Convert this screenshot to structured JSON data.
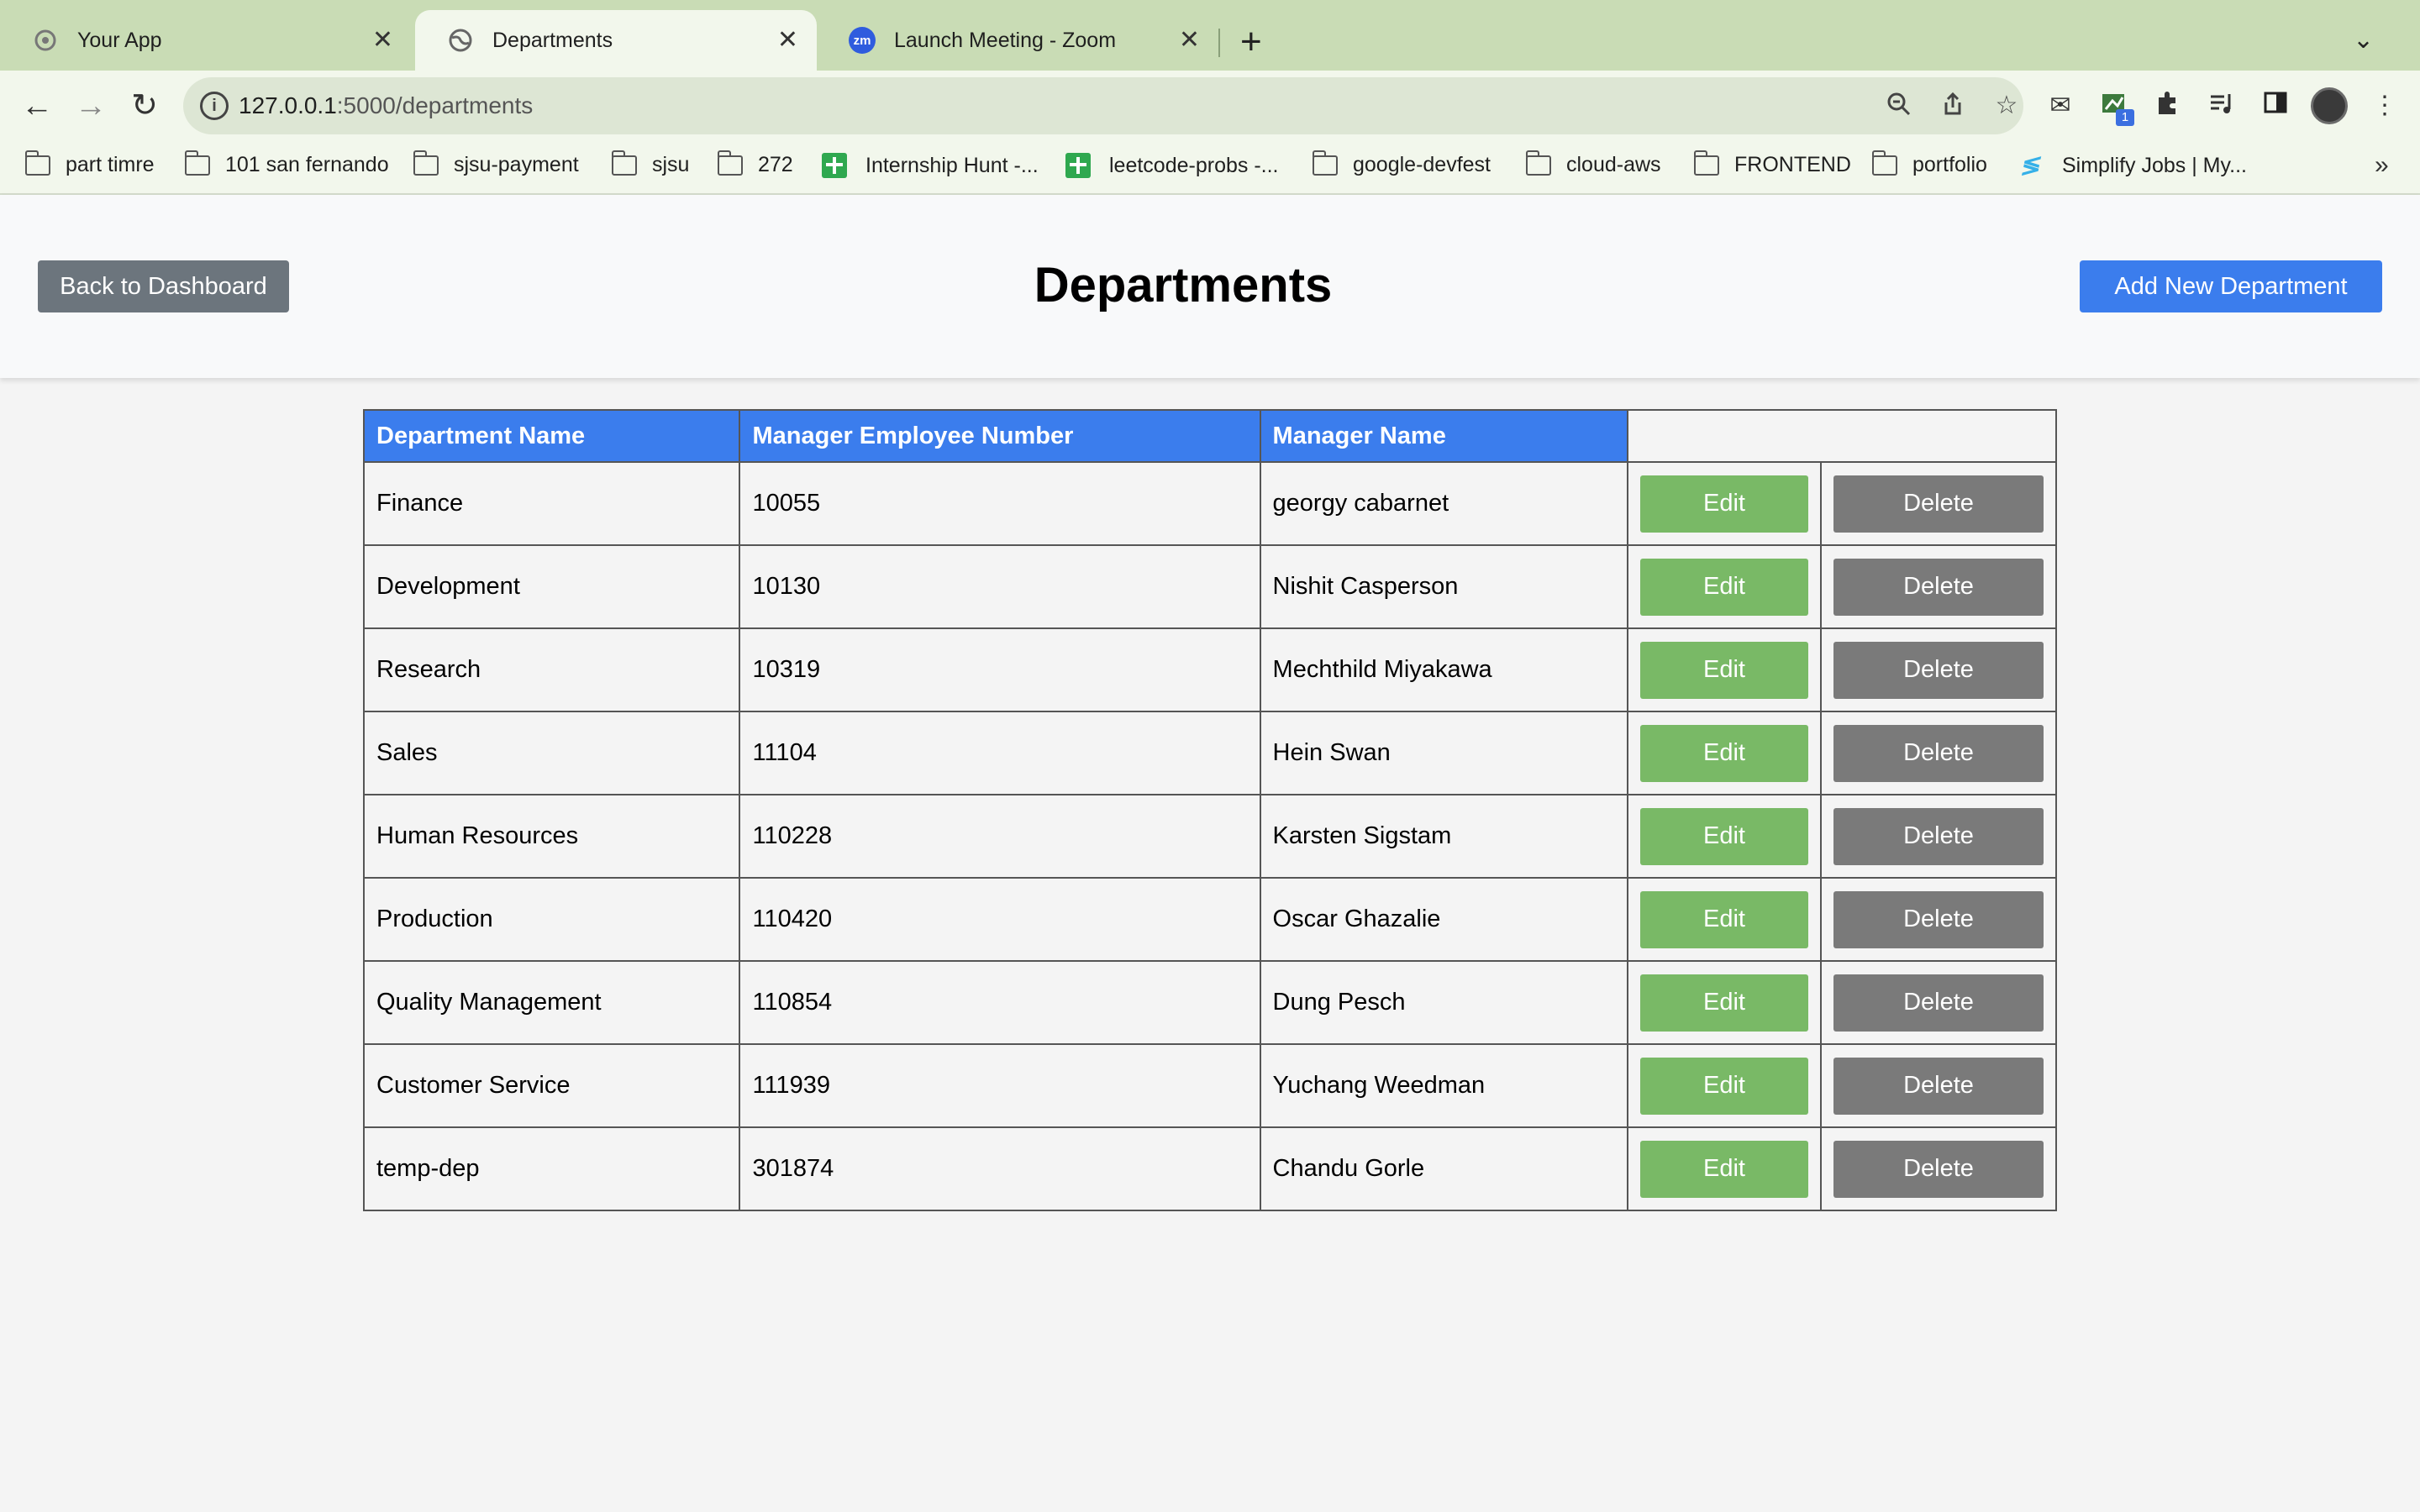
{
  "browser": {
    "tabs": [
      {
        "title": "Your App",
        "icon": "gear-icon"
      },
      {
        "title": "Departments",
        "icon": "globe-icon",
        "active": true
      },
      {
        "title": "Launch Meeting - Zoom",
        "icon": "zoom-icon",
        "icon_text": "zm"
      }
    ],
    "url_host": "127.0.0.1",
    "url_path": ":5000/departments",
    "extension_badge": "1",
    "bookmarks": [
      {
        "label": "part timre",
        "icon": "folder-icon"
      },
      {
        "label": "101 san fernando",
        "icon": "folder-icon"
      },
      {
        "label": "sjsu-payment",
        "icon": "folder-icon"
      },
      {
        "label": "sjsu",
        "icon": "folder-icon"
      },
      {
        "label": "272",
        "icon": "folder-icon"
      },
      {
        "label": "Internship Hunt -...",
        "icon": "sheets-icon"
      },
      {
        "label": "leetcode-probs -...",
        "icon": "sheets-icon"
      },
      {
        "label": "google-devfest",
        "icon": "folder-icon"
      },
      {
        "label": "cloud-aws",
        "icon": "folder-icon"
      },
      {
        "label": "FRONTEND",
        "icon": "folder-icon"
      },
      {
        "label": "portfolio",
        "icon": "folder-icon"
      },
      {
        "label": "Simplify Jobs | My...",
        "icon": "simplify-icon"
      }
    ]
  },
  "page": {
    "title": "Departments",
    "back_button": "Back to Dashboard",
    "add_button": "Add New Department",
    "colors": {
      "primary": "#3b7ded",
      "secondary": "#6c757d",
      "edit": "#79b966",
      "delete": "#7a7a7a"
    }
  },
  "table": {
    "headers": [
      "Department Name",
      "Manager Employee Number",
      "Manager Name"
    ],
    "edit_label": "Edit",
    "delete_label": "Delete",
    "rows": [
      {
        "dept": "Finance",
        "emp_no": "10055",
        "manager": "georgy cabarnet"
      },
      {
        "dept": "Development",
        "emp_no": "10130",
        "manager": "Nishit Casperson"
      },
      {
        "dept": "Research",
        "emp_no": "10319",
        "manager": "Mechthild Miyakawa"
      },
      {
        "dept": "Sales",
        "emp_no": "11104",
        "manager": "Hein Swan"
      },
      {
        "dept": "Human Resources",
        "emp_no": "110228",
        "manager": "Karsten Sigstam"
      },
      {
        "dept": "Production",
        "emp_no": "110420",
        "manager": "Oscar Ghazalie"
      },
      {
        "dept": "Quality Management",
        "emp_no": "110854",
        "manager": "Dung Pesch"
      },
      {
        "dept": "Customer Service",
        "emp_no": "111939",
        "manager": "Yuchang Weedman"
      },
      {
        "dept": "temp-dep",
        "emp_no": "301874",
        "manager": "Chandu Gorle"
      }
    ]
  }
}
